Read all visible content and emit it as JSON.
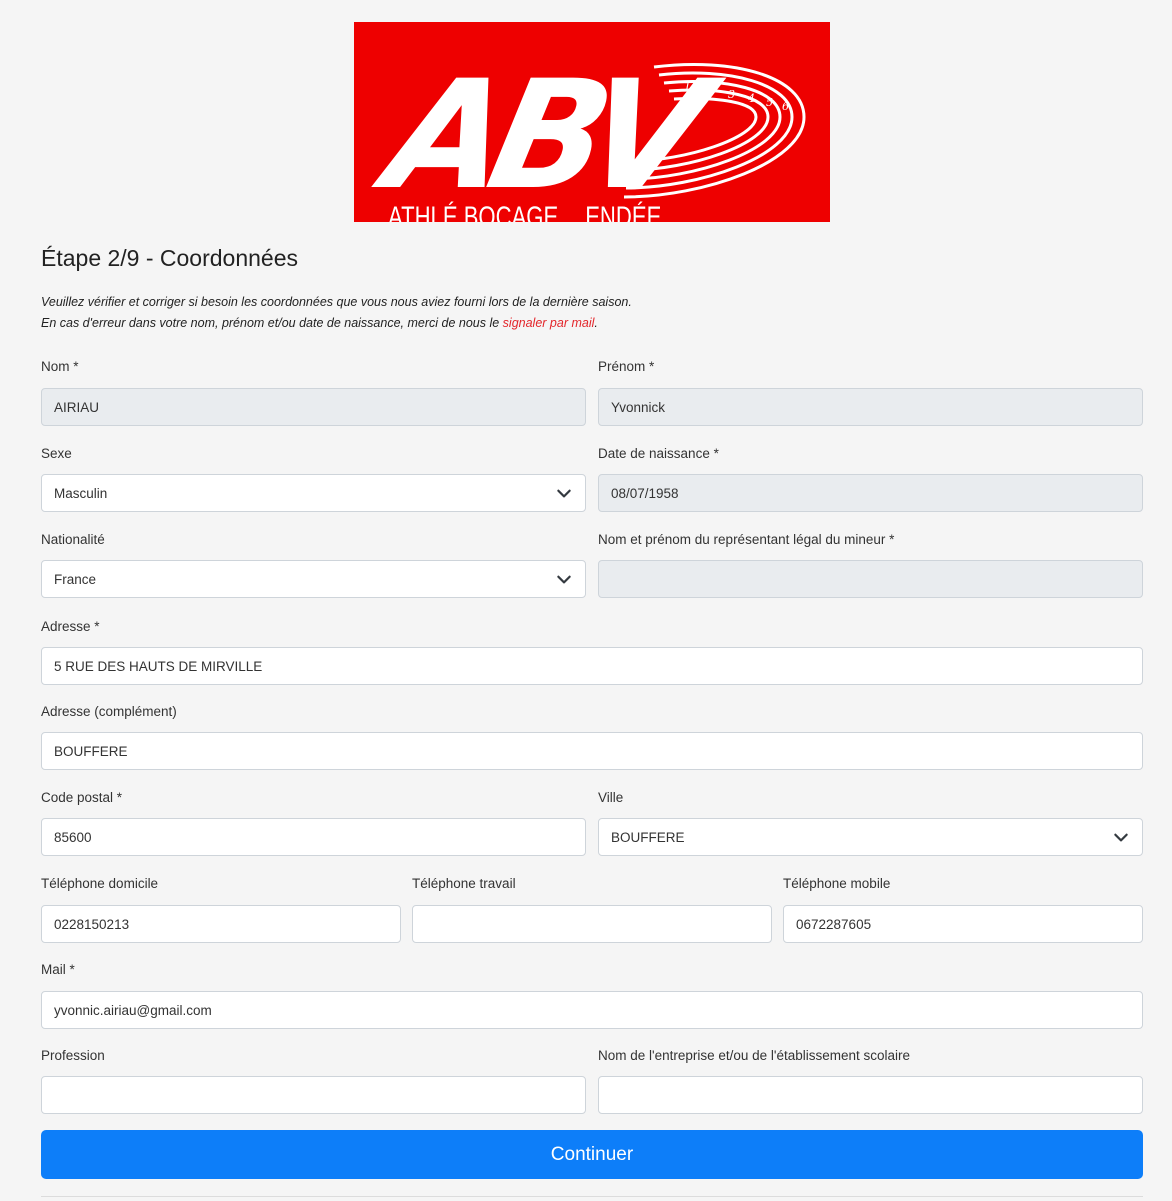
{
  "logo": {
    "letters": "ABV",
    "tagline_left": "ATHLÉ BOCAGE",
    "tagline_right": "ENDÉE",
    "lane_numbers": [
      "1",
      "2",
      "3",
      "4",
      "5",
      "6"
    ],
    "bg_color": "#ee0000"
  },
  "step_title": "Étape 2/9 - Coordonnées",
  "intro": {
    "line1": "Veuillez vérifier et corriger si besoin les coordonnées que vous nous aviez fourni lors de la dernière saison.",
    "line2_prefix": "En cas d'erreur dans votre nom, prénom et/ou date de naissance, merci de nous le ",
    "line2_link": "signaler par mail",
    "line2_suffix": "."
  },
  "form": {
    "nom": {
      "label": "Nom *",
      "value": "AIRIAU"
    },
    "prenom": {
      "label": "Prénom *",
      "value": "Yvonnick"
    },
    "sexe": {
      "label": "Sexe",
      "value": "Masculin"
    },
    "date_naissance": {
      "label": "Date de naissance *",
      "value": "08/07/1958"
    },
    "nationalite": {
      "label": "Nationalité",
      "value": "France"
    },
    "representant": {
      "label": "Nom et prénom du représentant légal du mineur *",
      "value": ""
    },
    "adresse": {
      "label": "Adresse *",
      "value": "5 RUE DES HAUTS DE MIRVILLE"
    },
    "adresse_complement": {
      "label": "Adresse (complément)",
      "value": "BOUFFERE"
    },
    "code_postal": {
      "label": "Code postal *",
      "value": "85600"
    },
    "ville": {
      "label": "Ville",
      "value": "BOUFFERE"
    },
    "tel_domicile": {
      "label": "Téléphone domicile",
      "value": "0228150213"
    },
    "tel_travail": {
      "label": "Téléphone travail",
      "value": ""
    },
    "tel_mobile": {
      "label": "Téléphone mobile",
      "value": "0672287605"
    },
    "mail": {
      "label": "Mail *",
      "value": "yvonnic.airiau@gmail.com"
    },
    "profession": {
      "label": "Profession",
      "value": ""
    },
    "entreprise": {
      "label": "Nom de l'entreprise et/ou de l'établissement scolaire",
      "value": ""
    }
  },
  "continue_button": "Continuer",
  "colors": {
    "primary": "#0d7ef9",
    "link": "#e3262b",
    "readonly_bg": "#e9ecef"
  }
}
